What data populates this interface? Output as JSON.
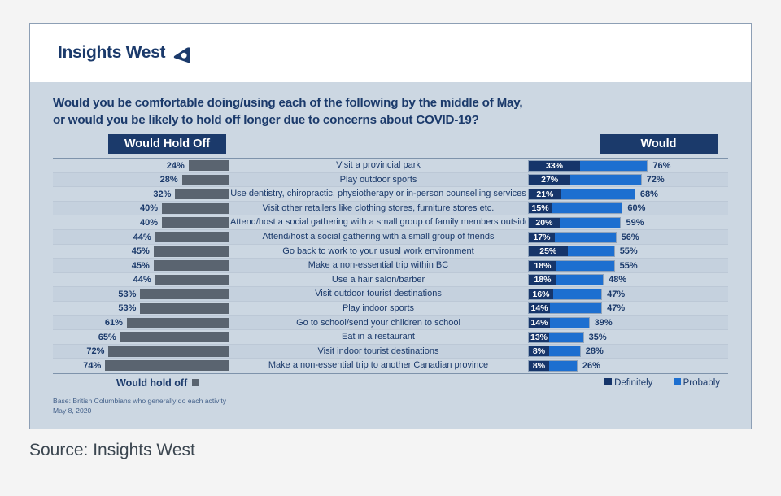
{
  "brand": {
    "name": "Insights West",
    "logo_icon": "insights-west-triangle-logo"
  },
  "question_line1": "Would you be comfortable doing/using each of the following by the middle of May,",
  "question_line2": "or would you be likely to hold off longer due to concerns about COVID-19?",
  "headers": {
    "left": "Would Hold Off",
    "right": "Would"
  },
  "legend": {
    "hold_off": "Would hold off",
    "definitely": "Definitely",
    "probably": "Probably"
  },
  "base_note_line1": "Base: British Columbians who generally do each activity",
  "base_note_line2": "May 8, 2020",
  "source_caption": "Source: Insights West",
  "colors": {
    "hold_off": "#5a6470",
    "definitely": "#16356a",
    "probably": "#1d6fd0",
    "panel_background": "#ccd7e2",
    "navy_text": "#1b3a6b"
  },
  "chart_data": {
    "type": "bar",
    "title": "Would you be comfortable doing/using each of the following by the middle of May, or would you be likely to hold off longer due to concerns about COVID-19?",
    "subtitle": "Base: British Columbians who generally do each activity",
    "xlabel": "",
    "ylabel": "",
    "orientation": "horizontal",
    "layout": "diverging-tornado",
    "grid": false,
    "legend_position": "bottom",
    "units": "percent",
    "xlim": [
      0,
      100
    ],
    "categories": [
      "Visit a provincial park",
      "Play outdoor sports",
      "Use dentistry, chiropractic, physiotherapy or in-person counselling services",
      "Visit other retailers like clothing stores, furniture stores etc.",
      "Attend/host a social gathering with a small group of family members outside your household",
      "Attend/host a social gathering with a small group of friends",
      "Go back to work to your usual work environment",
      "Make a non-essential trip within BC",
      "Use a hair salon/barber",
      "Visit outdoor tourist destinations",
      "Play indoor sports",
      "Go to school/send your children to school",
      "Eat in a restaurant",
      "Visit indoor tourist destinations",
      "Make a non-essential trip to another Canadian province"
    ],
    "series": [
      {
        "name": "Would hold off",
        "side": "left",
        "color": "#5a6470",
        "values": [
          24,
          28,
          32,
          40,
          40,
          44,
          45,
          45,
          44,
          53,
          53,
          61,
          65,
          72,
          74
        ]
      },
      {
        "name": "Definitely",
        "side": "right",
        "color": "#16356a",
        "values": [
          33,
          27,
          21,
          15,
          20,
          17,
          25,
          18,
          18,
          16,
          14,
          14,
          13,
          8,
          8
        ]
      },
      {
        "name": "Probably",
        "side": "right",
        "color": "#1d6fd0",
        "values": [
          43,
          45,
          47,
          45,
          39,
          39,
          30,
          37,
          30,
          31,
          33,
          25,
          22,
          20,
          18
        ]
      }
    ],
    "would_totals": [
      76,
      72,
      68,
      60,
      59,
      56,
      55,
      55,
      48,
      47,
      47,
      39,
      35,
      28,
      26
    ],
    "rows": [
      {
        "label": "Visit a provincial park",
        "hold_off": "24%",
        "definitely": "33%",
        "would_total": "76%"
      },
      {
        "label": "Play outdoor sports",
        "hold_off": "28%",
        "definitely": "27%",
        "would_total": "72%"
      },
      {
        "label": "Use dentistry, chiropractic, physiotherapy or in-person counselling services",
        "hold_off": "32%",
        "definitely": "21%",
        "would_total": "68%"
      },
      {
        "label": "Visit other retailers like clothing stores, furniture stores etc.",
        "hold_off": "40%",
        "definitely": "15%",
        "would_total": "60%"
      },
      {
        "label": "Attend/host a social gathering with a small group of family members outside your household",
        "hold_off": "40%",
        "definitely": "20%",
        "would_total": "59%"
      },
      {
        "label": "Attend/host a social gathering with a small group of friends",
        "hold_off": "44%",
        "definitely": "17%",
        "would_total": "56%"
      },
      {
        "label": "Go back to work to your usual work environment",
        "hold_off": "45%",
        "definitely": "25%",
        "would_total": "55%"
      },
      {
        "label": "Make a non-essential trip within BC",
        "hold_off": "45%",
        "definitely": "18%",
        "would_total": "55%"
      },
      {
        "label": "Use a hair salon/barber",
        "hold_off": "44%",
        "definitely": "18%",
        "would_total": "48%"
      },
      {
        "label": "Visit outdoor tourist destinations",
        "hold_off": "53%",
        "definitely": "16%",
        "would_total": "47%"
      },
      {
        "label": "Play indoor sports",
        "hold_off": "53%",
        "definitely": "14%",
        "would_total": "47%"
      },
      {
        "label": "Go to school/send your children to school",
        "hold_off": "61%",
        "definitely": "14%",
        "would_total": "39%"
      },
      {
        "label": "Eat in a restaurant",
        "hold_off": "65%",
        "definitely": "13%",
        "would_total": "35%"
      },
      {
        "label": "Visit indoor tourist destinations",
        "hold_off": "72%",
        "definitely": "8%",
        "would_total": "28%"
      },
      {
        "label": "Make a non-essential trip to another Canadian province",
        "hold_off": "74%",
        "definitely": "8%",
        "would_total": "26%"
      }
    ]
  }
}
